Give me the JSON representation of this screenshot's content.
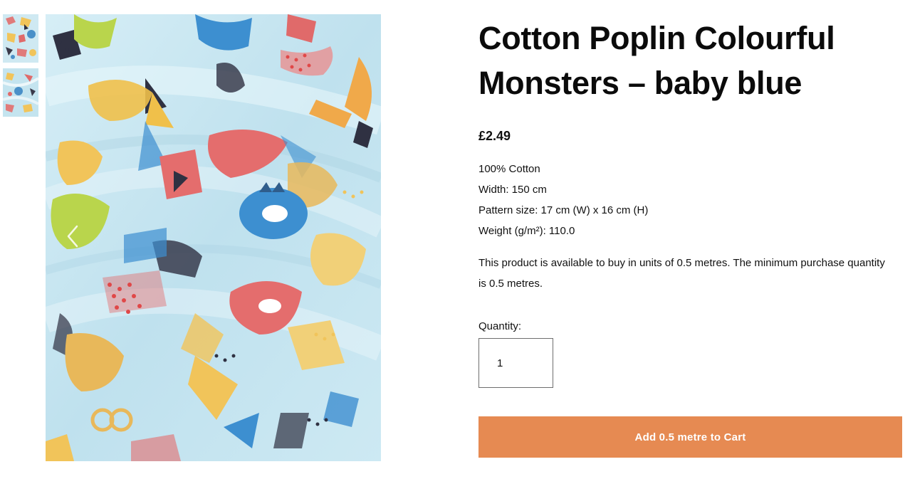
{
  "product": {
    "title": "Cotton Poplin Colourful Monsters – baby blue",
    "price": "£2.49",
    "specs": [
      "100% Cotton",
      "Width: 150 cm",
      "Pattern size: 17 cm (W) x 16 cm (H)",
      "Weight (g/m²): 110.0"
    ],
    "availability": "This product is available to buy in units of 0.5 metres. The minimum purchase quantity is 0.5 metres."
  },
  "purchase": {
    "quantity_label": "Quantity:",
    "quantity_value": "1",
    "cart_button_label": "Add 0.5 metre to Cart"
  },
  "gallery": {
    "thumbnails": [
      "fabric-flat-thumbnail",
      "fabric-draped-thumbnail"
    ],
    "prev_icon": "chevron-left-icon"
  },
  "colors": {
    "accent": "#e68a52",
    "fabric_background": "#c6e5f0"
  }
}
